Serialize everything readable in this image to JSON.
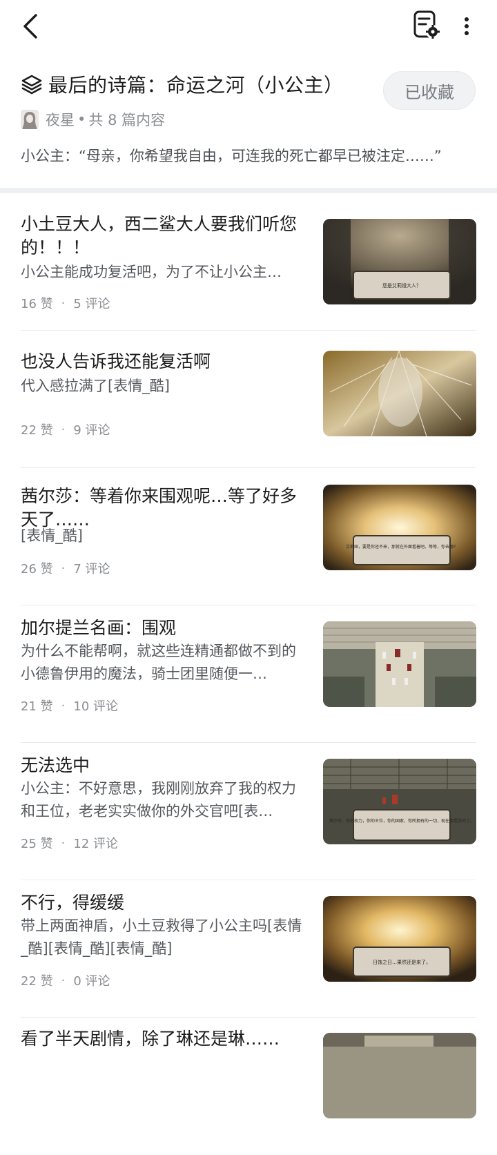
{
  "topbar": {
    "back_icon": "chevron-left-icon",
    "doc_settings_icon": "document-settings-icon",
    "more_icon": "more-vertical-icon"
  },
  "header": {
    "title": "最后的诗篇：命运之河（小公主）",
    "title_icon": "layers-icon",
    "favorite_label": "已收藏",
    "author": "夜星",
    "meta_separator": "•",
    "count_text": "共 8 篇内容",
    "quote": "小公主：“母亲，你希望我自由，可连我的死亡都早已被注定……”"
  },
  "items": [
    {
      "title": "小土豆大人，西二鲨大人要我们听您的！！！",
      "desc": "小公主能成功复活吧，为了不让小公主…",
      "likes": "16 赞",
      "comments": "5 评论",
      "thumb_caption": "您是艾莉娅大人？"
    },
    {
      "title": "也没人告诉我还能复活啊",
      "desc": "代入感拉满了[表情_酷]",
      "likes": "22 赞",
      "comments": "9 评论",
      "thumb_caption": ""
    },
    {
      "title": "茜尔莎：等着你来围观呢…等了好多天了……",
      "desc": "[表情_酷]",
      "likes": "26 赞",
      "comments": "7 评论",
      "thumb_caption": "艾莉娅，要是你还不来，那就在外面看着吧。等等，你去哪？"
    },
    {
      "title": "加尔提兰名画：围观",
      "desc": "为什么不能帮啊，就这些连精通都做不到的小德鲁伊用的魔法，骑士团里随便一…",
      "likes": "21 赞",
      "comments": "10 评论",
      "thumb_caption": ""
    },
    {
      "title": "无法选中",
      "desc": "小公主：不好意思，我刚刚放弃了我的权力和王位，老老实实做你的外交官吧[表…",
      "likes": "25 赞",
      "comments": "12 评论",
      "thumb_caption": "茜尔莎，你的权力，你的王位，你的国家，你所拥有的一切，现在都是我的了。"
    },
    {
      "title": "不行，得缓缓",
      "desc": "带上两面神盾，小土豆救得了小公主吗[表情_酷][表情_酷][表情_酷]",
      "likes": "22 赞",
      "comments": "0 评论",
      "thumb_caption": "日蚀之日…果然还是来了。"
    },
    {
      "title": "看了半天剧情，除了琳还是琳……",
      "desc": "",
      "likes": "",
      "comments": "",
      "thumb_caption": ""
    }
  ],
  "colors": {
    "favorite_bg": "#f0f2f4",
    "text_primary": "#1c1c1c",
    "text_secondary": "#55595e",
    "text_muted": "#8a8d92",
    "divider": "#eef0f2"
  }
}
